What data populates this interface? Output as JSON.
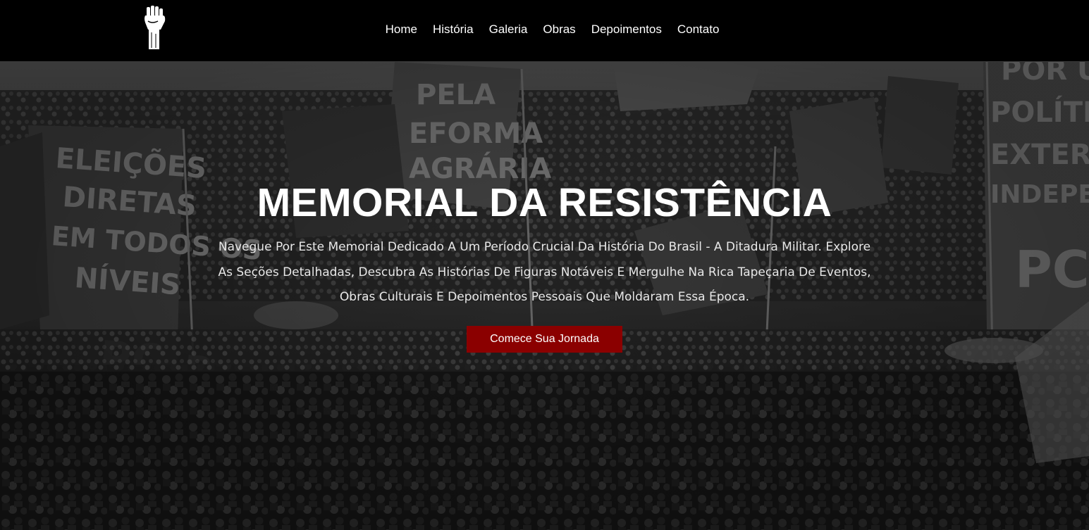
{
  "nav": {
    "logo_icon": "raised-fist-icon",
    "items": [
      {
        "label": "Home"
      },
      {
        "label": "História"
      },
      {
        "label": "Galeria"
      },
      {
        "label": "Obras"
      },
      {
        "label": "Depoimentos"
      },
      {
        "label": "Contato"
      }
    ]
  },
  "hero": {
    "title": "MEMORIAL DA RESISTÊNCIA",
    "description": "Navegue Por Este Memorial Dedicado A Um Período Crucial Da História Do Brasil - A Ditadura Militar. Explore As Seções Detalhadas, Descubra As Histórias De Figuras Notáveis E Mergulhe Na Rica Tapeçaria De Eventos, Obras Culturais E Depoimentos Pessoais Que Moldaram Essa Época.",
    "button_label": "Comece Sua Jornada",
    "background_image": "black-and-white-protest-crowd-with-banners",
    "banner_texts": [
      "ELEIÇÕES DIRETAS EM TODOS OS NÍVEIS",
      "PC do B",
      "PELA REFORMA AGRÁRIA",
      "POR UMA POLÍTICA EXTERNA INDEPENDENTE"
    ]
  },
  "colors": {
    "accent": "#8b0000",
    "nav_bg": "#000000",
    "text": "#ffffff"
  }
}
